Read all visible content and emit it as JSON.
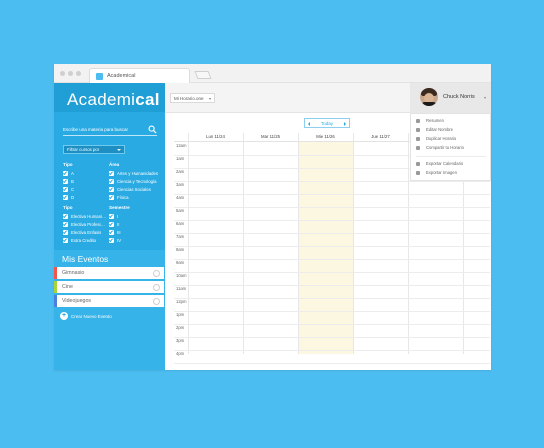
{
  "browser": {
    "tab_title": "Academical"
  },
  "app": {
    "logo_light": "Academi",
    "logo_bold": "cal",
    "search_placeholder": "Escribe una materia para buscar",
    "filter_label": "Filtrar cursos por",
    "filters": [
      {
        "heading": "Tipo",
        "items": [
          {
            "label": "A",
            "checked": true
          },
          {
            "label": "B",
            "checked": true
          },
          {
            "label": "C",
            "checked": true
          },
          {
            "label": "D",
            "checked": true
          }
        ]
      },
      {
        "heading": "Área",
        "items": [
          {
            "label": "Artes y Humanidades",
            "checked": true
          },
          {
            "label": "Ciencia y Tecnología",
            "checked": true
          },
          {
            "label": "Ciencias Sociales",
            "checked": true
          },
          {
            "label": "Física",
            "checked": true
          }
        ]
      },
      {
        "heading": "Tipo",
        "items": [
          {
            "label": "Electiva Humani…",
            "checked": true
          },
          {
            "label": "Electiva Profesi…",
            "checked": true
          },
          {
            "label": "Electiva Enfasis",
            "checked": true
          },
          {
            "label": "Extra Credito",
            "checked": true
          }
        ]
      },
      {
        "heading": "Semestre",
        "items": [
          {
            "label": "I",
            "checked": true
          },
          {
            "label": "II",
            "checked": true
          },
          {
            "label": "III",
            "checked": true
          },
          {
            "label": "IV",
            "checked": true
          }
        ]
      }
    ],
    "events_title": "Mis Eventos",
    "events": [
      {
        "label": "Gimnasio",
        "color": "#f0574a"
      },
      {
        "label": "Cine",
        "color": "#a7d43a"
      },
      {
        "label": "Videojuegos",
        "color": "#4d7fe0"
      }
    ],
    "create_event_label": "Crear Nuevo Evento"
  },
  "topbar": {
    "schedule_select": "Mi Horario.one",
    "user_name": "Chuck Norris"
  },
  "calendar": {
    "today_label": "Today",
    "days": [
      "Lun 11/24",
      "Mar 11/25",
      "Mie 11/26",
      "Jue 11/27"
    ],
    "today_index": 2,
    "today_color": "#fbf7e1",
    "times": [
      "12am",
      "1am",
      "2am",
      "3am",
      "4am",
      "5am",
      "6am",
      "7am",
      "8am",
      "9am",
      "10am",
      "11am",
      "12pm",
      "1pm",
      "2pm",
      "3pm",
      "4pm"
    ]
  },
  "user_menu": {
    "items": [
      {
        "label": "Resumen",
        "icon": "summary-icon"
      },
      {
        "label": "Editar Nombre",
        "icon": "pencil-icon"
      },
      {
        "label": "Duplicar Horario",
        "icon": "duplicate-icon"
      },
      {
        "label": "Compartir tu Horario",
        "icon": "share-icon"
      },
      {
        "label": "Exportar Calendario",
        "icon": "calendar-icon"
      },
      {
        "label": "Exportar Imagen",
        "icon": "image-icon"
      }
    ]
  },
  "colors": {
    "background": "#4cbdf0",
    "sidebar": "#2aaae2",
    "accent": "#2aaae2"
  }
}
